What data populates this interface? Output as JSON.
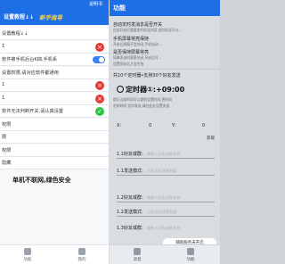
{
  "left": {
    "status": {
      "right_text": "说明书"
    },
    "header": {
      "title": "设置教程↓↓",
      "highlight": "新手指导"
    },
    "rows": [
      {
        "text": "设置教程↓↓",
        "control": "none"
      },
      {
        "text": "1",
        "control": "red-x"
      },
      {
        "text": "软件被手机后台K掉,手机系",
        "control": "switch-on"
      },
      {
        "text": "设置权限,请对应软件都通用",
        "control": "none"
      },
      {
        "text": "1",
        "control": "red-x"
      },
      {
        "text": "1",
        "control": "red-x"
      },
      {
        "text": "软件无法判断开关,请认真设置",
        "control": "green-check"
      },
      {
        "text": "权限",
        "control": "none"
      },
      {
        "text": "限",
        "control": "none"
      },
      {
        "text": "权限",
        "control": "none"
      },
      {
        "text": "隐藏",
        "control": "none"
      }
    ],
    "slogan": "单机不联网,绿色安全",
    "nav": [
      {
        "icon": "home-icon",
        "label": "功能"
      },
      {
        "icon": "user-icon",
        "label": "我的"
      }
    ]
  },
  "right": {
    "header": {
      "title": "功能"
    },
    "items": [
      {
        "title": "自动定时发消息是否开关",
        "sub": "在此开启后需要定时发送内容,定时发送可以..."
      },
      {
        "title": "手机屏幕常亮保持",
        "sub": "开启后屏幕不会关闭,手机自动..."
      },
      {
        "title": "是否保持屏幕常亮",
        "sub": "如果发送时屏幕关闭,开启后可..."
      }
    ],
    "note": "设置保存后才会生效",
    "list_line": "共10个定时器•支持30个好友发送",
    "timer": {
      "label": "定时器①:",
      "value": "+09:00"
    },
    "timer_sub1": "提示当前时间可以提前设置时间,把时间",
    "timer_sub2": "定的时间 定时发送,请在此处设置发送",
    "xy": {
      "x_label": "X:",
      "x_value": "0",
      "y_label": "Y:",
      "y_value": "0"
    },
    "get_label": "获取",
    "fields": [
      {
        "label": "1.1好友或群:",
        "placeholder": "请输入好友或群名称"
      },
      {
        "label": "1.1发送模式:",
        "placeholder": "已发送的消息数量"
      },
      {
        "label": "1.2好友或群:",
        "placeholder": "请输入好友或群名称"
      },
      {
        "label": "1.2发送模式:",
        "placeholder": "已发送的消息数量"
      },
      {
        "label": "1.3好友或群:",
        "placeholder": "请输入好友或群名称"
      }
    ],
    "toast": "辅助服务未开启",
    "nav": [
      {
        "icon": "chat-icon",
        "label": "消息"
      },
      {
        "icon": "grid-icon",
        "label": "功能"
      }
    ]
  }
}
